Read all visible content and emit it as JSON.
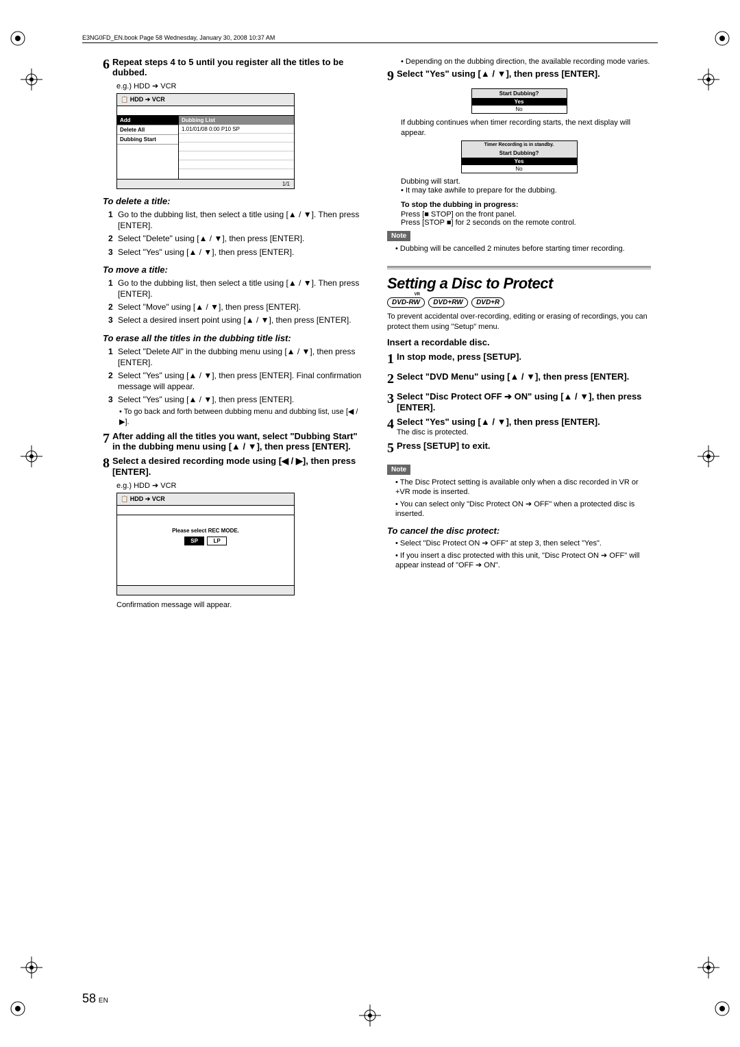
{
  "doc_header": "E3NG0FD_EN.book  Page 58  Wednesday, January 30, 2008  10:37 AM",
  "left": {
    "step6": {
      "num": "6",
      "text": "Repeat steps 4 to 5 until you register all the titles to be dubbed.",
      "eg": "e.g.) HDD ➔ VCR",
      "panel": {
        "title_icon": "📋",
        "title": "HDD ➔ VCR",
        "menu": {
          "add": "Add",
          "delete_all": "Delete All",
          "dubbing_start": "Dubbing Start"
        },
        "dub_header": "Dubbing List",
        "dub_row": "1.01/01/08 0:00 P10 SP",
        "footer": "1/1"
      }
    },
    "delete": {
      "head": "To delete a title:",
      "i1_num": "1",
      "i1": "Go to the dubbing list, then select a title using [▲ / ▼]. Then press [ENTER].",
      "i2_num": "2",
      "i2": "Select \"Delete\" using [▲ / ▼], then press [ENTER].",
      "i3_num": "3",
      "i3": "Select \"Yes\" using [▲ / ▼], then press [ENTER]."
    },
    "move": {
      "head": "To move a title:",
      "i1_num": "1",
      "i1": "Go to the dubbing list, then select a title using [▲ / ▼]. Then press [ENTER].",
      "i2_num": "2",
      "i2": "Select \"Move\" using [▲ / ▼], then press [ENTER].",
      "i3_num": "3",
      "i3": "Select a desired insert point using [▲ / ▼], then press [ENTER]."
    },
    "erase": {
      "head": "To erase all the titles in the dubbing title list:",
      "i1_num": "1",
      "i1": "Select \"Delete All\" in the dubbing menu using [▲ / ▼], then press [ENTER].",
      "i2_num": "2",
      "i2": "Select \"Yes\" using [▲ / ▼], then press [ENTER]. Final confirmation message will appear.",
      "i3_num": "3",
      "i3": "Select \"Yes\" using [▲ / ▼], then press [ENTER].",
      "tip": "To go back and forth between dubbing menu and dubbing list, use [◀ / ▶]."
    },
    "step7": {
      "num": "7",
      "text": "After adding all the titles you want, select \"Dubbing Start\" in the dubbing menu using [▲ / ▼], then press [ENTER]."
    },
    "step8": {
      "num": "8",
      "text": "Select a desired recording mode using [◀ / ▶], then press [ENTER].",
      "eg": "e.g.) HDD ➔ VCR",
      "panel": {
        "title": "HDD ➔ VCR",
        "msg": "Please select REC MODE.",
        "sp": "SP",
        "lp": "LP"
      },
      "after": "Confirmation message will appear."
    }
  },
  "right": {
    "pre9": "Depending on the dubbing direction, the available recording mode varies.",
    "step9": {
      "num": "9",
      "text": "Select \"Yes\" using [▲ / ▼], then press [ENTER].",
      "dlg1": {
        "title": "Start Dubbing?",
        "yes": "Yes",
        "no": "No"
      },
      "mid": "If dubbing continues when timer recording starts, the next display will appear.",
      "dlg2": {
        "pre": "Timer Recording is in standby.",
        "title": "Start Dubbing?",
        "yes": "Yes",
        "no": "No"
      },
      "after1": "Dubbing will start.",
      "after2": "It may take awhile to prepare for the dubbing.",
      "stop_head": "To stop the dubbing in progress:",
      "stop1": "Press [■ STOP] on the front panel.",
      "stop2": "Press [STOP ■] for 2 seconds on the remote control."
    },
    "note": "Note",
    "note1": "Dubbing will be cancelled 2 minutes before starting timer recording.",
    "section": {
      "title": "Setting a Disc to Protect",
      "badges": {
        "b1": "DVD-RW",
        "b2": "DVD+RW",
        "b3": "DVD+R"
      },
      "intro": "To prevent accidental over-recording, editing or erasing of recordings, you can protect them using \"Setup\" menu.",
      "insert": "Insert a recordable disc.",
      "s1_num": "1",
      "s1": "In stop mode, press [SETUP].",
      "s2_num": "2",
      "s2": "Select \"DVD Menu\" using [▲ / ▼], then press [ENTER].",
      "s3_num": "3",
      "s3": "Select \"Disc Protect OFF ➔ ON\" using [▲ / ▼], then press [ENTER].",
      "s4_num": "4",
      "s4": "Select \"Yes\" using [▲ / ▼], then press [ENTER].",
      "s4_after": "The disc is protected.",
      "s5_num": "5",
      "s5": "Press [SETUP] to exit.",
      "note2a": "The Disc Protect setting is available only when a disc recorded in VR or +VR mode is inserted.",
      "note2b": "You can select only \"Disc Protect ON ➔ OFF\" when a protected disc is inserted.",
      "cancel_head": "To cancel the disc protect:",
      "cancel1": "Select \"Disc Protect ON ➔ OFF\" at step 3, then select \"Yes\".",
      "cancel2": "If you insert a disc protected with this unit, \"Disc Protect ON ➔ OFF\" will appear instead of \"OFF ➔ ON\"."
    }
  },
  "page_num": "58",
  "page_lang": "EN"
}
